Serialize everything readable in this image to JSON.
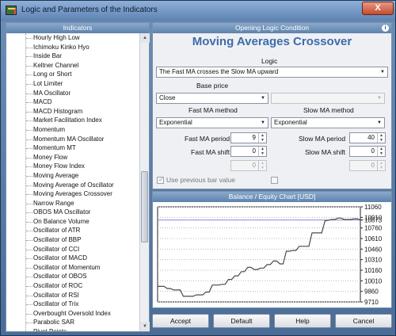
{
  "window": {
    "title": "Logic and Parameters of the Indicators",
    "close_label": "X"
  },
  "indicators": {
    "header": "Indicators",
    "items": [
      "Hourly High Low",
      "Ichimoku Kinko Hyo",
      "Inside Bar",
      "Keltner Channel",
      "Long or Short",
      "Lot Limiter",
      "MA Oscillator",
      "MACD",
      "MACD Histogram",
      "Market Facilitation Index",
      "Momentum",
      "Momentum MA Oscillator",
      "Momentum MT",
      "Money Flow",
      "Money Flow Index",
      "Moving Average",
      "Moving Average of Oscillator",
      "Moving Averages Crossover",
      "Narrow Range",
      "OBOS MA Oscillator",
      "On Balance Volume",
      "Oscillator of ATR",
      "Oscillator of BBP",
      "Oscillator of CCI",
      "Oscillator of MACD",
      "Oscillator of Momentum",
      "Oscillator of OBOS",
      "Oscillator of ROC",
      "Oscillator of RSI",
      "Oscillator of Trix",
      "Overbought Oversold Index",
      "Parabolic SAR",
      "Pivot Points"
    ]
  },
  "logic_panel": {
    "header": "Opening Logic Condition",
    "indicator_name": "Moving Averages Crossover",
    "logic_label": "Logic",
    "logic_value": "The Fast MA crosses the Slow MA upward",
    "base_price_label": "Base price",
    "base_price_value": "Close",
    "base_price_second_value": "",
    "fast_ma_method_label": "Fast MA method",
    "fast_ma_method_value": "Exponential",
    "slow_ma_method_label": "Slow MA method",
    "slow_ma_method_value": "Exponential",
    "fast_ma_period_label": "Fast MA period",
    "fast_ma_period_value": "9",
    "slow_ma_period_label": "Slow MA period",
    "slow_ma_period_value": "40",
    "fast_ma_shift_label": "Fast MA shift",
    "fast_ma_shift_value": "0",
    "slow_ma_shift_label": "Slow MA shift",
    "slow_ma_shift_value": "0",
    "extra_left_value": "0",
    "extra_right_value": "0",
    "use_previous_bar_label": "Use previous bar value"
  },
  "chart_data": {
    "type": "line",
    "title": "Balance / Equity Chart [USD]",
    "ylim": [
      9710,
      11060
    ],
    "y_ticks": [
      11060,
      10910,
      10873,
      10760,
      10610,
      10460,
      10310,
      10160,
      10010,
      9860,
      9710
    ],
    "current_value_label": "10873",
    "grid": true,
    "series": [
      {
        "color": "#4a4a4a",
        "values": [
          9930,
          9930,
          9930,
          9900,
          9900,
          9880,
          9880,
          9880,
          9790,
          9790,
          9790,
          9790,
          9810,
          9810,
          9810,
          9850,
          9850,
          9950,
          9950,
          9950,
          9960,
          9960,
          10030,
          10030,
          10080,
          10080,
          10140,
          10140,
          10200,
          10200,
          10170,
          10170,
          10190,
          10190,
          10240,
          10240,
          10290,
          10290,
          10250,
          10250,
          10430,
          10430,
          10440,
          10440,
          10500,
          10500,
          10500,
          10500,
          10690,
          10690,
          10690,
          10690,
          10860,
          10870,
          10880,
          10880,
          10900,
          10900,
          10880,
          10880,
          10880,
          10890,
          10890,
          10873
        ]
      }
    ]
  },
  "buttons": {
    "accept": "Accept",
    "default": "Default",
    "help": "Help",
    "cancel": "Cancel"
  }
}
